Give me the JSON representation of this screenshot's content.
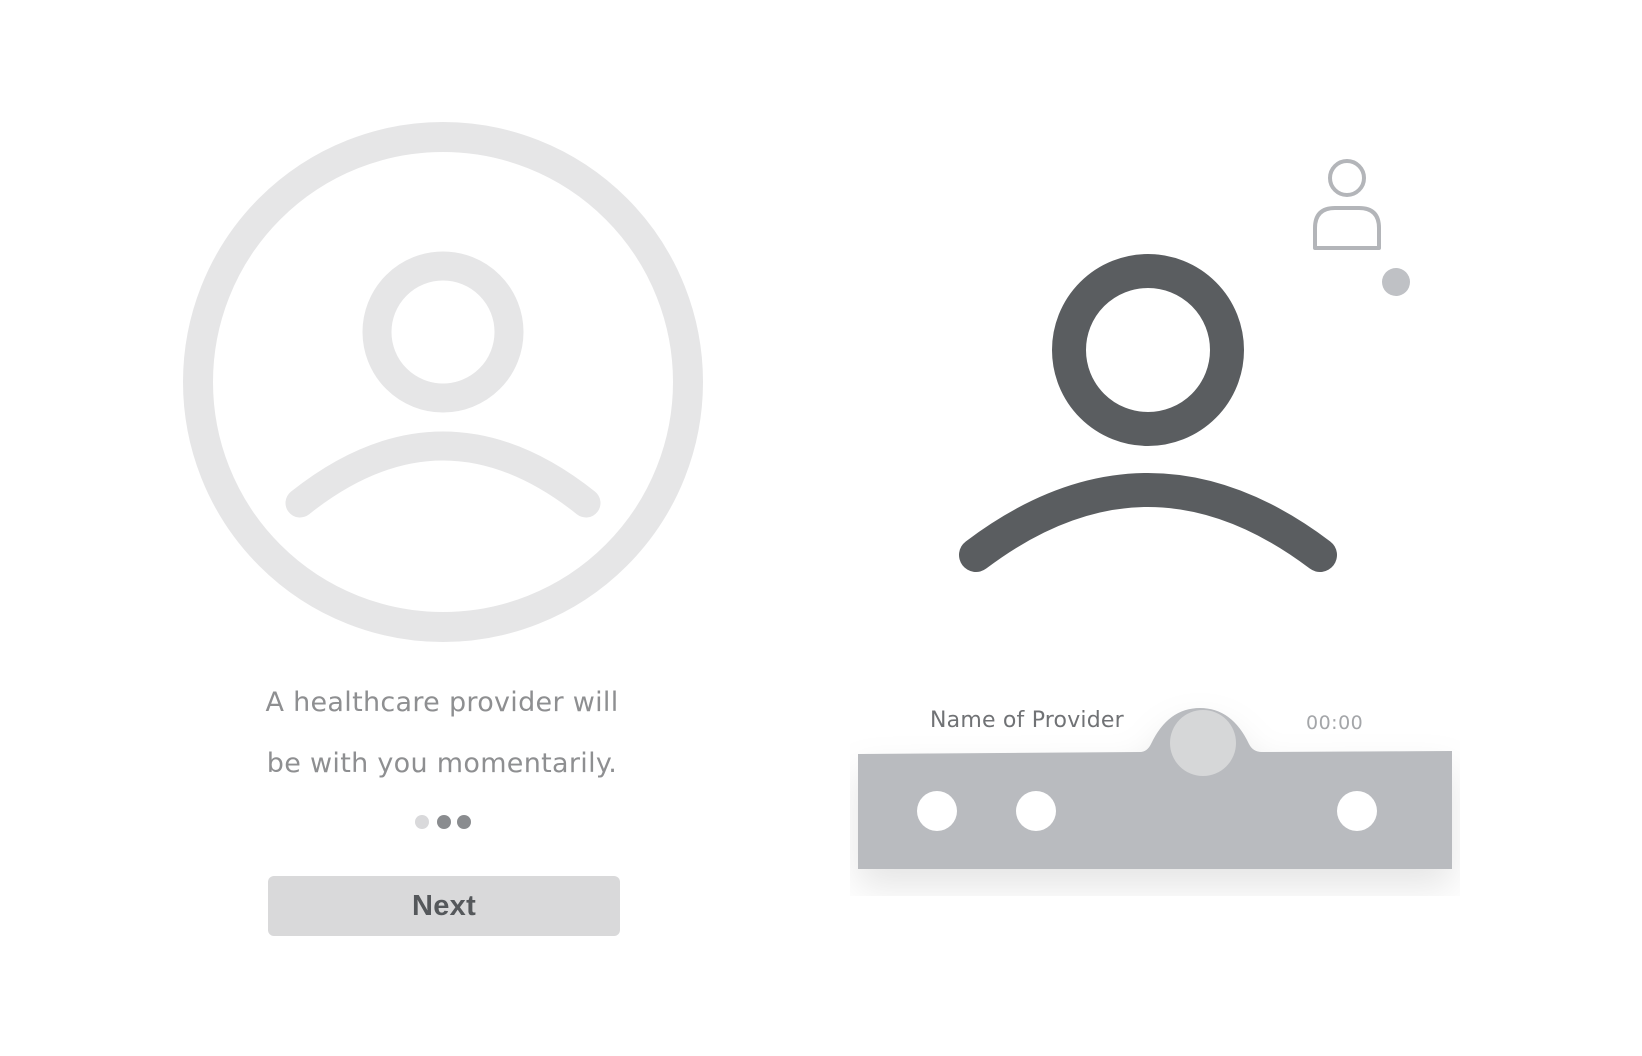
{
  "waiting": {
    "message_line1": "A healthcare provider will",
    "message_line2": "be with you momentarily.",
    "avatar_icon": "user-circle-icon",
    "loading_dots": 3
  },
  "actions": {
    "next_label": "Next"
  },
  "call": {
    "provider_name": "Name of Provider",
    "timer": "00:00",
    "provider_avatar_icon": "user-icon",
    "self_view_icon": "person-outline-icon",
    "controls": [
      "control-button-left",
      "control-button-middle",
      "control-button-right"
    ]
  },
  "colors": {
    "light_gray": "#e6e6e7",
    "dark_gray": "#5a5d60",
    "bar_gray": "#b9bbbf",
    "dot_light": "#d9d9db",
    "dot_dark": "#8a8c8f",
    "status_dot": "#bfc1c5",
    "outline_icon": "#b3b5b9",
    "button_bg": "#d9d9da",
    "button_text": "#55585b",
    "text_gray": "#8e8f91"
  }
}
